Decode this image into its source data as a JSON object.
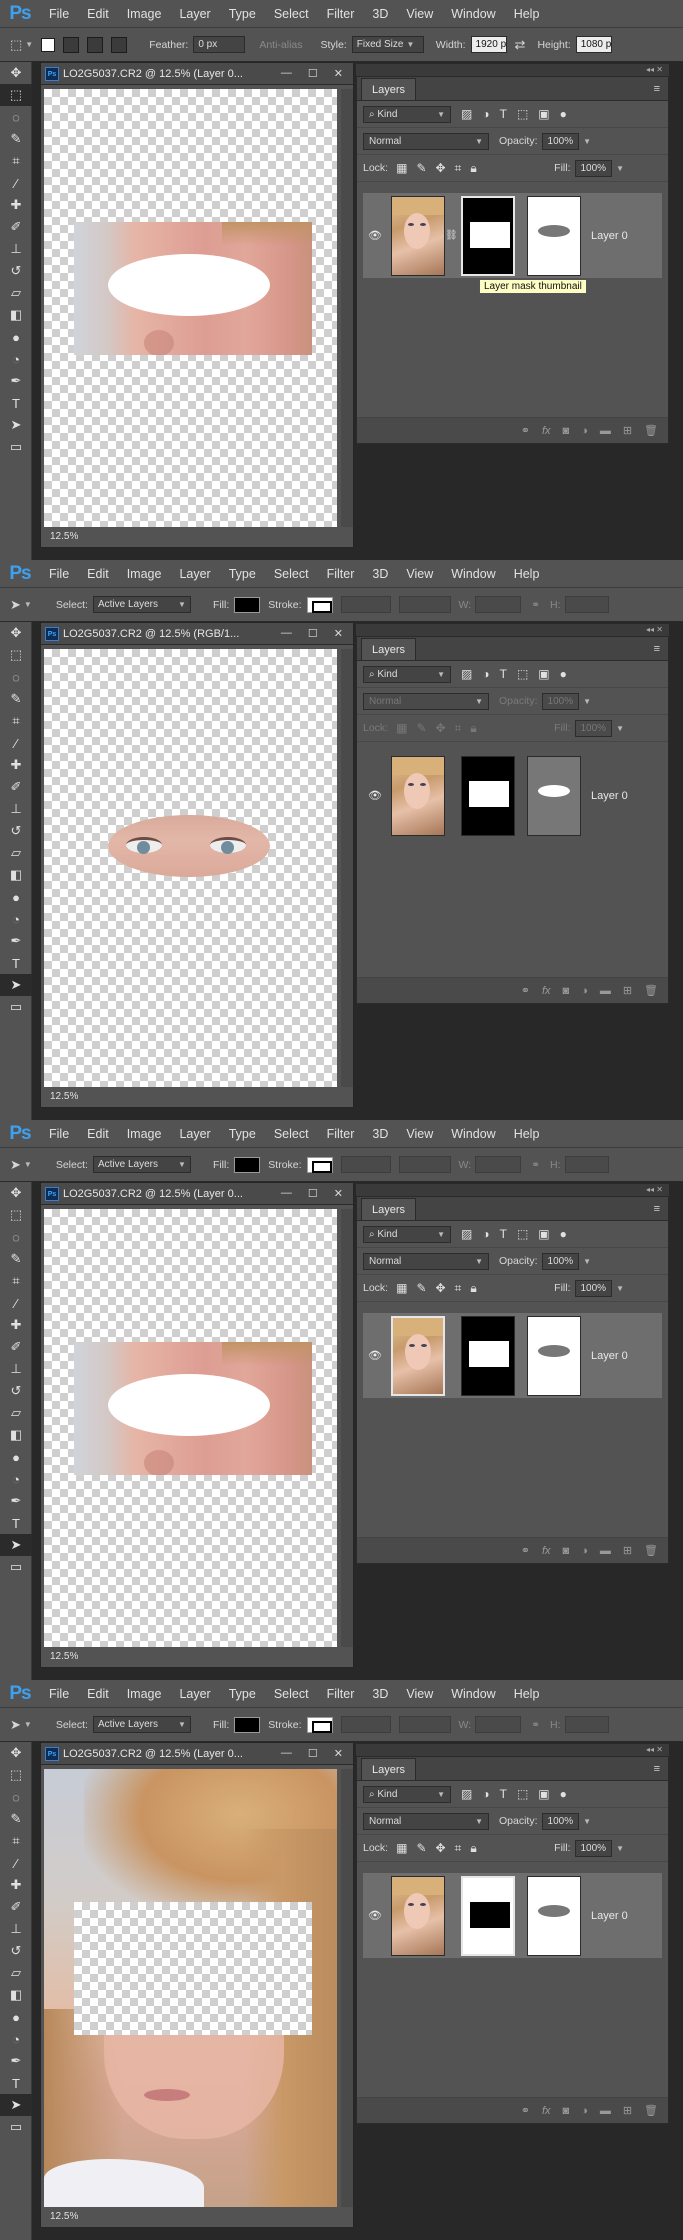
{
  "menubar": {
    "logo": "Ps",
    "items": [
      "File",
      "Edit",
      "Image",
      "Layer",
      "Type",
      "Select",
      "Filter",
      "3D",
      "View",
      "Window",
      "Help"
    ]
  },
  "optbar_marquee": {
    "feather_label": "Feather:",
    "feather_value": "0 px",
    "antialias_label": "Anti-alias",
    "style_label": "Style:",
    "style_value": "Fixed Size",
    "width_label": "Width:",
    "width_value": "1920 p",
    "height_label": "Height:",
    "height_value": "1080 p"
  },
  "optbar_path": {
    "select_label": "Select:",
    "select_value": "Active Layers",
    "fill_label": "Fill:",
    "stroke_label": "Stroke:",
    "w_label": "W:",
    "h_label": "H:"
  },
  "document": {
    "titles": [
      "LO2G5037.CR2 @ 12.5% (Layer 0...",
      "LO2G5037.CR2 @ 12.5% (RGB/1...",
      "LO2G5037.CR2 @ 12.5% (Layer 0...",
      "LO2G5037.CR2 @ 12.5% (Layer 0..."
    ],
    "zoom": "12.5%"
  },
  "layers_panel": {
    "tab_label": "Layers",
    "kind_label": "Kind",
    "blend_mode": "Normal",
    "opacity_label": "Opacity:",
    "opacity_value": "100%",
    "lock_label": "Lock:",
    "fill_label": "Fill:",
    "fill_value": "100%",
    "layer_name": "Layer 0",
    "bottom_icons": [
      "link-icon",
      "fx-icon",
      "add-mask-icon",
      "adjustment-icon",
      "folder-icon",
      "new-layer-icon",
      "trash-icon"
    ]
  },
  "tooltip": "Layer mask thumbnail",
  "colors": {
    "chrome": "#535353",
    "background": "#282828",
    "ps_blue": "#3ea0f0",
    "tooltip_bg": "#fdfdc4"
  }
}
